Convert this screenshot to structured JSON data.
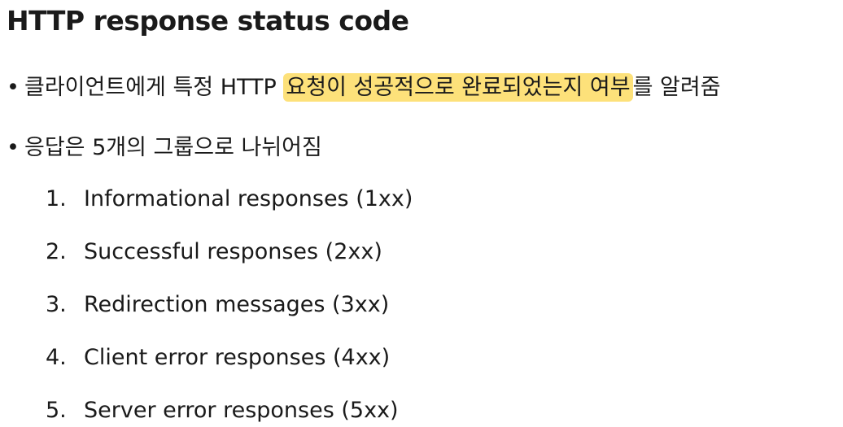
{
  "title": "HTTP response status code",
  "bullets": [
    {
      "marker": "•",
      "before": "클라이언트에게 특정 HTTP ",
      "highlight": "요청이 성공적으로 완료되었는지 여부",
      "after": "를 알려줌"
    },
    {
      "marker": "•",
      "text": "응답은 5개의 그룹으로 나뉘어짐"
    }
  ],
  "groups": [
    {
      "number": "1.",
      "label": "Informational responses (1xx)"
    },
    {
      "number": "2.",
      "label": "Successful responses (2xx)"
    },
    {
      "number": "3.",
      "label": "Redirection messages (3xx)"
    },
    {
      "number": "4.",
      "label": "Client error responses (4xx)"
    },
    {
      "number": "5.",
      "label": "Server error responses (5xx)"
    }
  ],
  "colors": {
    "highlight": "#fde17a",
    "text": "#1a1a1a"
  }
}
